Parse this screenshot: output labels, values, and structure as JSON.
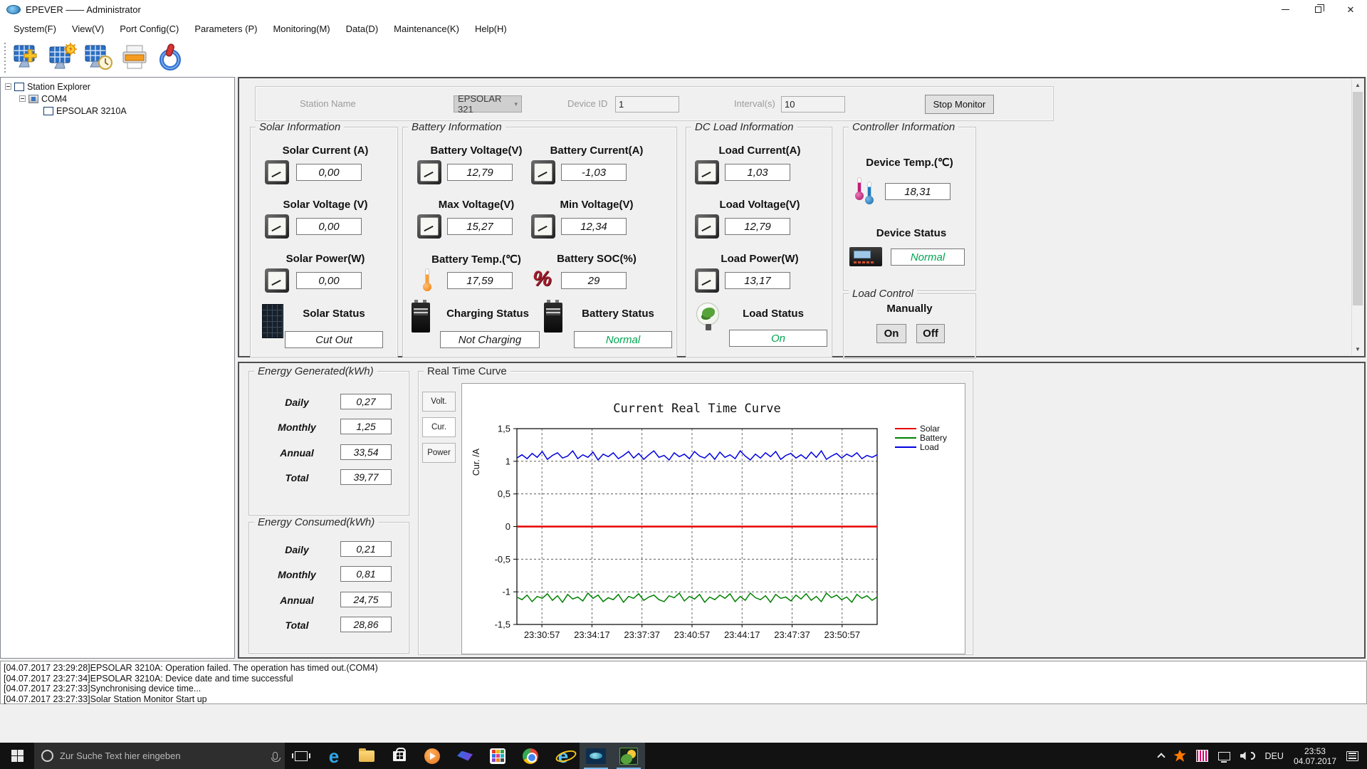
{
  "window": {
    "title": "EPEVER —— Administrator"
  },
  "menu": {
    "items": [
      "System(F)",
      "View(V)",
      "Port Config(C)",
      "Parameters (P)",
      "Monitoring(M)",
      "Data(D)",
      "Maintenance(K)",
      "Help(H)"
    ]
  },
  "toolbar": {
    "icons": [
      "add-station-icon",
      "station-settings-icon",
      "station-time-icon",
      "print-icon",
      "power-icon"
    ]
  },
  "tree": {
    "items": [
      {
        "label": "Station Explorer"
      },
      {
        "label": "COM4"
      },
      {
        "label": "EPSOLAR 3210A"
      }
    ]
  },
  "station_bar": {
    "station_name_label": "Station Name",
    "station_name": "EPSOLAR 321",
    "device_id_label": "Device ID",
    "device_id": "1",
    "interval_label": "Interval(s)",
    "interval": "10",
    "stop_monitor": "Stop Monitor"
  },
  "colors": {
    "status_green": "#00a651",
    "status_black": "#1a1a1a",
    "solar_series": "#e60000",
    "battery_series": "#008000",
    "load_series": "#0000e0"
  },
  "solar": {
    "title": "Solar Information",
    "metrics": [
      {
        "label": "Solar Current (A)",
        "value": "0,00"
      },
      {
        "label": "Solar Voltage (V)",
        "value": "0,00"
      },
      {
        "label": "Solar Power(W)",
        "value": "0,00"
      }
    ],
    "status_label": "Solar Status",
    "status": "Cut Out",
    "status_color": "#1a1a1a"
  },
  "battery": {
    "title": "Battery Information",
    "metrics_left": [
      {
        "label": "Battery Voltage(V)",
        "value": "12,79"
      },
      {
        "label": "Max Voltage(V)",
        "value": "15,27"
      },
      {
        "label": "Battery Temp.(℃)",
        "value": "17,59"
      }
    ],
    "metrics_right": [
      {
        "label": "Battery Current(A)",
        "value": "-1,03"
      },
      {
        "label": "Min Voltage(V)",
        "value": "12,34"
      },
      {
        "label": "Battery SOC(%)",
        "value": "29"
      }
    ],
    "charging_status_label": "Charging Status",
    "charging_status": "Not Charging",
    "charging_status_color": "#1a1a1a",
    "battery_status_label": "Battery Status",
    "battery_status": "Normal",
    "battery_status_color": "#00a651"
  },
  "dc_load": {
    "title": "DC Load Information",
    "metrics": [
      {
        "label": "Load Current(A)",
        "value": "1,03"
      },
      {
        "label": "Load Voltage(V)",
        "value": "12,79"
      },
      {
        "label": "Load Power(W)",
        "value": "13,17"
      }
    ],
    "status_label": "Load Status",
    "status": "On",
    "status_color": "#00a651"
  },
  "controller": {
    "title": "Controller Information",
    "temp_label": "Device Temp.(℃)",
    "temp": "18,31",
    "status_label": "Device Status",
    "status": "Normal",
    "status_color": "#00a651"
  },
  "load_control": {
    "title": "Load Control",
    "manually_label": "Manually",
    "on": "On",
    "off": "Off"
  },
  "energy_generated": {
    "title": "Energy Generated(kWh)",
    "rows": [
      {
        "label": "Daily",
        "value": "0,27"
      },
      {
        "label": "Monthly",
        "value": "1,25"
      },
      {
        "label": "Annual",
        "value": "33,54"
      },
      {
        "label": "Total",
        "value": "39,77"
      }
    ]
  },
  "energy_consumed": {
    "title": "Energy Consumed(kWh)",
    "rows": [
      {
        "label": "Daily",
        "value": "0,21"
      },
      {
        "label": "Monthly",
        "value": "0,81"
      },
      {
        "label": "Annual",
        "value": "24,75"
      },
      {
        "label": "Total",
        "value": "28,86"
      }
    ]
  },
  "realtime": {
    "title": "Real Time Curve",
    "tabs": [
      "Volt.",
      "Cur.",
      "Power"
    ],
    "active_tab": "Cur."
  },
  "chart_data": {
    "type": "line",
    "title": "Current Real Time Curve",
    "ylabel": "Cur. /A",
    "ylim": [
      -1.5,
      1.5
    ],
    "grid": "dashed",
    "legend_position": "right-top",
    "yticks": [
      {
        "value": 1.5,
        "label": "1,5"
      },
      {
        "value": 1,
        "label": "1"
      },
      {
        "value": 0.5,
        "label": "0,5"
      },
      {
        "value": 0,
        "label": "0"
      },
      {
        "value": -0.5,
        "label": "-0,5"
      },
      {
        "value": -1,
        "label": "-1"
      },
      {
        "value": -1.5,
        "label": "-1,5"
      }
    ],
    "xticks": {
      "range_s": [
        0,
        1440
      ],
      "positions_s": [
        100,
        300,
        500,
        700,
        900,
        1100,
        1300
      ],
      "labels": [
        "23:30:57",
        "23:34:17",
        "23:37:37",
        "23:40:57",
        "23:44:17",
        "23:47:37",
        "23:50:57"
      ]
    },
    "series": [
      {
        "name": "Solar",
        "color": "#e60000",
        "constant": 0
      },
      {
        "name": "Battery",
        "color": "#008000",
        "values": [
          -1.08,
          -1.12,
          -1.05,
          -1.15,
          -1.07,
          -1.1,
          -1.03,
          -1.13,
          -1.06,
          -1.16,
          -1.04,
          -1.11,
          -1.08,
          -1.14,
          -1.02,
          -1.1,
          -1.05,
          -1.15,
          -1.09,
          -1.12,
          -1.04,
          -1.16,
          -1.07,
          -1.1,
          -1.03,
          -1.13,
          -1.08,
          -1.05,
          -1.12,
          -1.15,
          -1.06,
          -1.09,
          -1.02,
          -1.14,
          -1.07,
          -1.11,
          -1.04,
          -1.16,
          -1.08,
          -1.12,
          -1.05,
          -1.1,
          -1.03,
          -1.15,
          -1.07,
          -1.13,
          -1.02,
          -1.09,
          -1.12,
          -1.06,
          -1.16,
          -1.04,
          -1.1,
          -1.08,
          -1.14,
          -1.05,
          -1.11,
          -1.03,
          -1.13,
          -1.07,
          -1.15,
          -1.02,
          -1.09,
          -1.05,
          -1.12,
          -1.08,
          -1.16,
          -1.04,
          -1.1,
          -1.06,
          -1.13,
          -1.08
        ]
      },
      {
        "name": "Load",
        "color": "#0000e0",
        "values": [
          1.05,
          1.1,
          1.04,
          1.12,
          1.06,
          1.15,
          1.03,
          1.09,
          1.13,
          1.05,
          1.08,
          1.16,
          1.04,
          1.1,
          1.06,
          1.14,
          1.02,
          1.11,
          1.07,
          1.13,
          1.04,
          1.09,
          1.15,
          1.05,
          1.12,
          1.03,
          1.1,
          1.16,
          1.06,
          1.09,
          1.02,
          1.13,
          1.07,
          1.11,
          1.04,
          1.15,
          1.08,
          1.05,
          1.12,
          1.03,
          1.14,
          1.06,
          1.1,
          1.04,
          1.16,
          1.08,
          1.02,
          1.11,
          1.05,
          1.13,
          1.07,
          1.15,
          1.03,
          1.09,
          1.12,
          1.05,
          1.1,
          1.04,
          1.14,
          1.06,
          1.16,
          1.03,
          1.08,
          1.12,
          1.05,
          1.11,
          1.07,
          1.13,
          1.04,
          1.09,
          1.06,
          1.1
        ]
      }
    ]
  },
  "log": {
    "lines": [
      "[04.07.2017 23:29:28]EPSOLAR 3210A: Operation failed. The operation has timed out.(COM4)",
      "[04.07.2017 23:27:34]EPSOLAR 3210A: Device date and time successful",
      "[04.07.2017 23:27:33]Synchronising device time...",
      "[04.07.2017 23:27:33]Solar Station Monitor Start up"
    ]
  },
  "taskbar": {
    "search_placeholder": "Zur Suche Text hier eingeben",
    "tray": {
      "language": "DEU",
      "time": "23:53",
      "date": "04.07.2017"
    }
  }
}
